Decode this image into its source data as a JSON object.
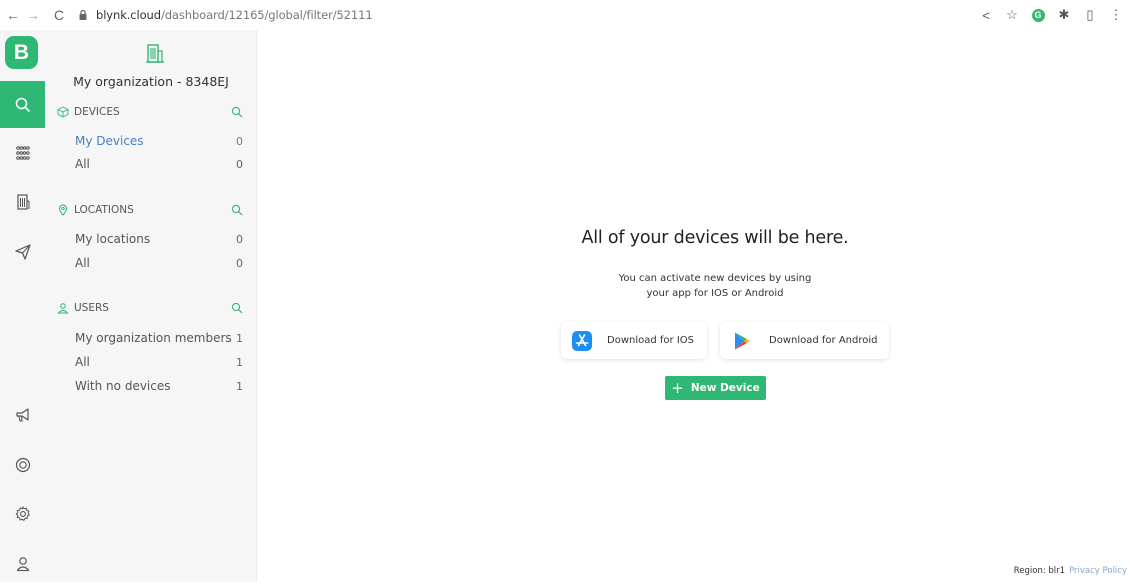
{
  "browser": {
    "url_host": "blynk.cloud",
    "url_path": "/dashboard/12165/global/filter/52111"
  },
  "app": {
    "logo_letter": "B"
  },
  "rail": {
    "items": [
      {
        "icon": "search-icon"
      },
      {
        "icon": "grid-icon"
      },
      {
        "icon": "building-icon"
      },
      {
        "icon": "send-icon"
      },
      {
        "icon": "megaphone-icon"
      },
      {
        "icon": "lifebuoy-icon"
      },
      {
        "icon": "settings-icon"
      },
      {
        "icon": "user-icon"
      }
    ],
    "active": "search-icon"
  },
  "sidebar": {
    "org_name": "My organization - 8348EJ",
    "sections": [
      {
        "title": "DEVICES",
        "icon": "cube-icon",
        "rows": [
          {
            "label": "My Devices",
            "count": "0",
            "selected": true
          },
          {
            "label": "All",
            "count": "0"
          }
        ]
      },
      {
        "title": "LOCATIONS",
        "icon": "location-pin-icon",
        "rows": [
          {
            "label": "My locations",
            "count": "0"
          },
          {
            "label": "All",
            "count": "0"
          }
        ]
      },
      {
        "title": "USERS",
        "icon": "user-icon",
        "rows": [
          {
            "label": "My organization members",
            "count": "1"
          },
          {
            "label": "All",
            "count": "1"
          },
          {
            "label": "With no devices",
            "count": "1"
          }
        ]
      }
    ]
  },
  "main": {
    "title": "All of your devices will be here.",
    "subtitle_line1": "You can activate new devices by using",
    "subtitle_line2": "your app for IOS or Android",
    "ios_button": "Download for IOS",
    "android_button": "Download for Android",
    "new_device_button": "New Device",
    "new_device_plus": "+"
  },
  "footer": {
    "region": "Region: blr1",
    "privacy": "Privacy Policy"
  },
  "colors": {
    "accent": "#2eb873",
    "selected_link": "#4a7fc4",
    "sidebar_bg": "#f6f6f6"
  }
}
